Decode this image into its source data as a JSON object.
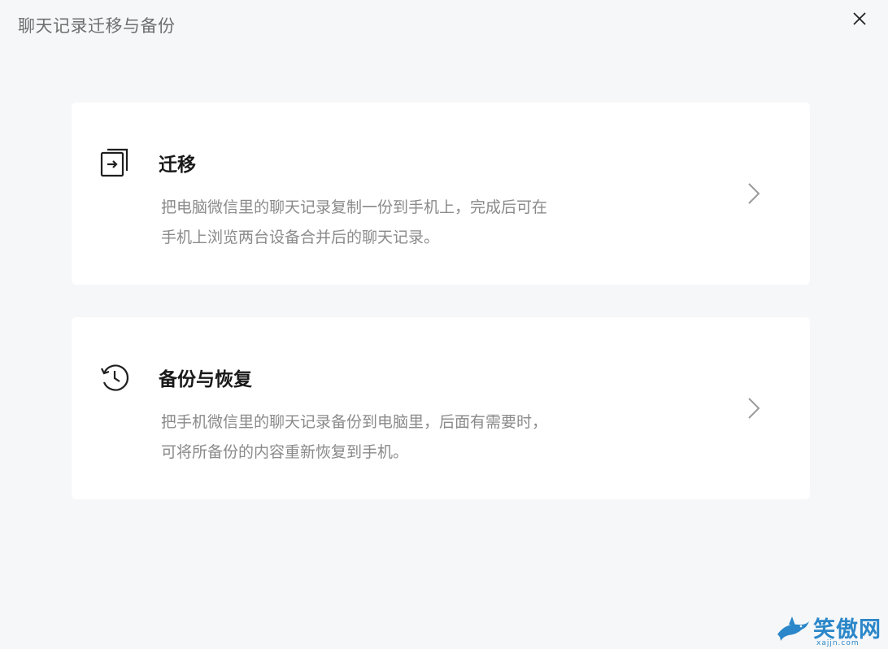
{
  "window": {
    "title": "聊天记录迁移与备份"
  },
  "icons": {
    "close": "close-icon",
    "migrate": "migrate-icon",
    "backup": "history-restore-icon",
    "chevron": "chevron-right-icon"
  },
  "cards": [
    {
      "title": "迁移",
      "desc_line1": "把电脑微信里的聊天记录复制一份到手机上，完成后可在",
      "desc_line2": "手机上浏览两台设备合并后的聊天记录。"
    },
    {
      "title": "备份与恢复",
      "desc_line1": "把手机微信里的聊天记录备份到电脑里，后面有需要时，",
      "desc_line2": "可将所备份的内容重新恢复到手机。"
    }
  ],
  "watermark": {
    "text": "笑傲网",
    "sub": "xajjn.com"
  },
  "colors": {
    "background": "#f6f7f9",
    "card": "#ffffff",
    "title_text": "#6f6f6f",
    "desc_text": "#8a8a8a",
    "watermark": "#2b87c9"
  }
}
